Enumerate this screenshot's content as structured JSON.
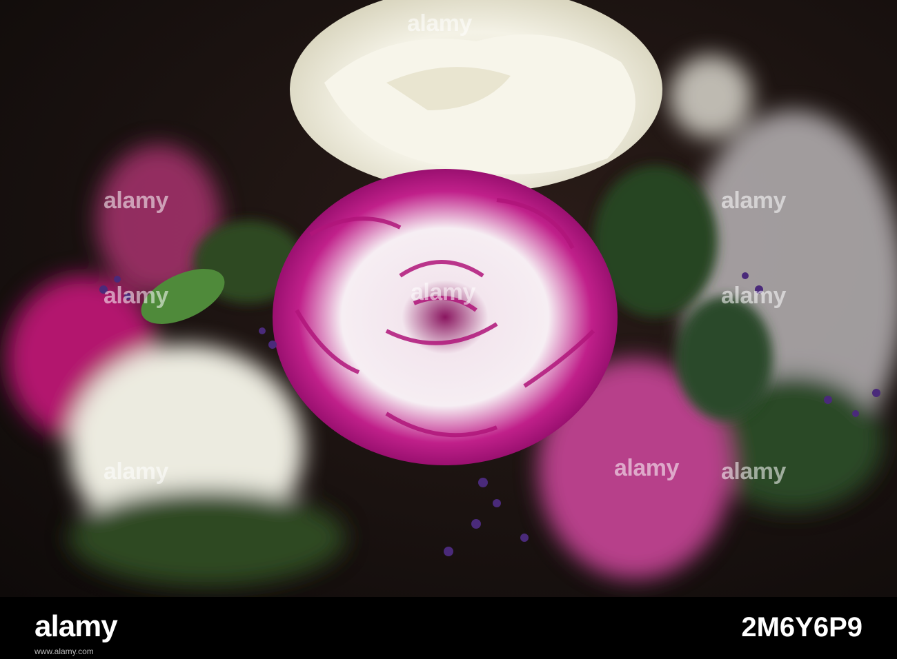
{
  "watermark": {
    "text": "alamy"
  },
  "footer": {
    "logo": "alamy",
    "image_id": "2M6Y6P9",
    "site": "www.alamy.com"
  },
  "colors": {
    "rose": "#f1efe0",
    "carnation_edge": "#b0157a",
    "carnation_center": "#f3e6ee",
    "statice": "#4a2a7a",
    "leaf": "#2f4a22",
    "background": "#1a1210"
  }
}
